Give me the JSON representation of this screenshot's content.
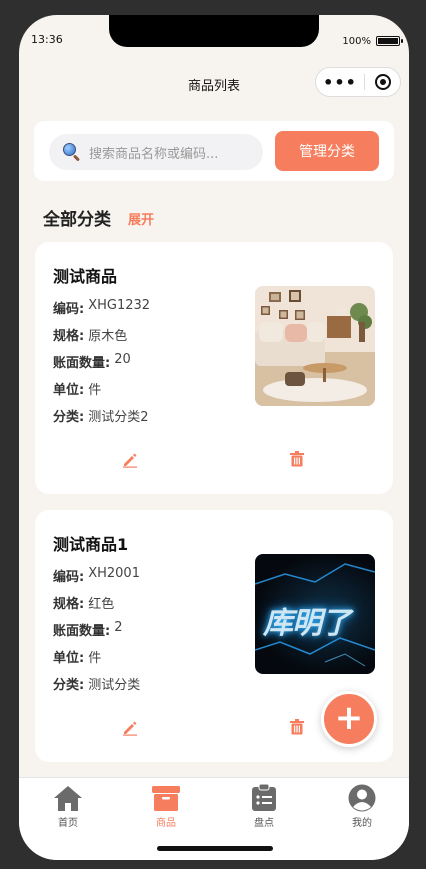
{
  "status": {
    "time": "13:36",
    "battery": "100%"
  },
  "nav": {
    "title": "商品列表"
  },
  "search": {
    "placeholder": "搜索商品名称或编码...",
    "manage_label": "管理分类"
  },
  "category": {
    "title": "全部分类",
    "expand_label": "展开"
  },
  "field_labels": {
    "code": "编码:",
    "spec": "规格:",
    "qty": "账面数量:",
    "unit": "单位:",
    "category": "分类:"
  },
  "products": [
    {
      "name": "测试商品",
      "code": "XHG1232",
      "spec": "原木色",
      "qty": "20",
      "unit": "件",
      "category": "测试分类2",
      "image": "living-room-sofa-photo"
    },
    {
      "name": "测试商品1",
      "code": "XH2001",
      "spec": "红色",
      "qty": "2",
      "unit": "件",
      "category": "测试分类",
      "image": "glowing-text-photo",
      "image_text": "库明了"
    }
  ],
  "tabbar": [
    {
      "label": "首页",
      "icon": "home-icon"
    },
    {
      "label": "商品",
      "icon": "archive-box-icon",
      "active": true
    },
    {
      "label": "盘点",
      "icon": "clipboard-list-icon"
    },
    {
      "label": "我的",
      "icon": "user-circle-icon"
    }
  ],
  "colors": {
    "accent": "#f67e5e",
    "background": "#f7f3ef",
    "card": "#ffffff"
  }
}
